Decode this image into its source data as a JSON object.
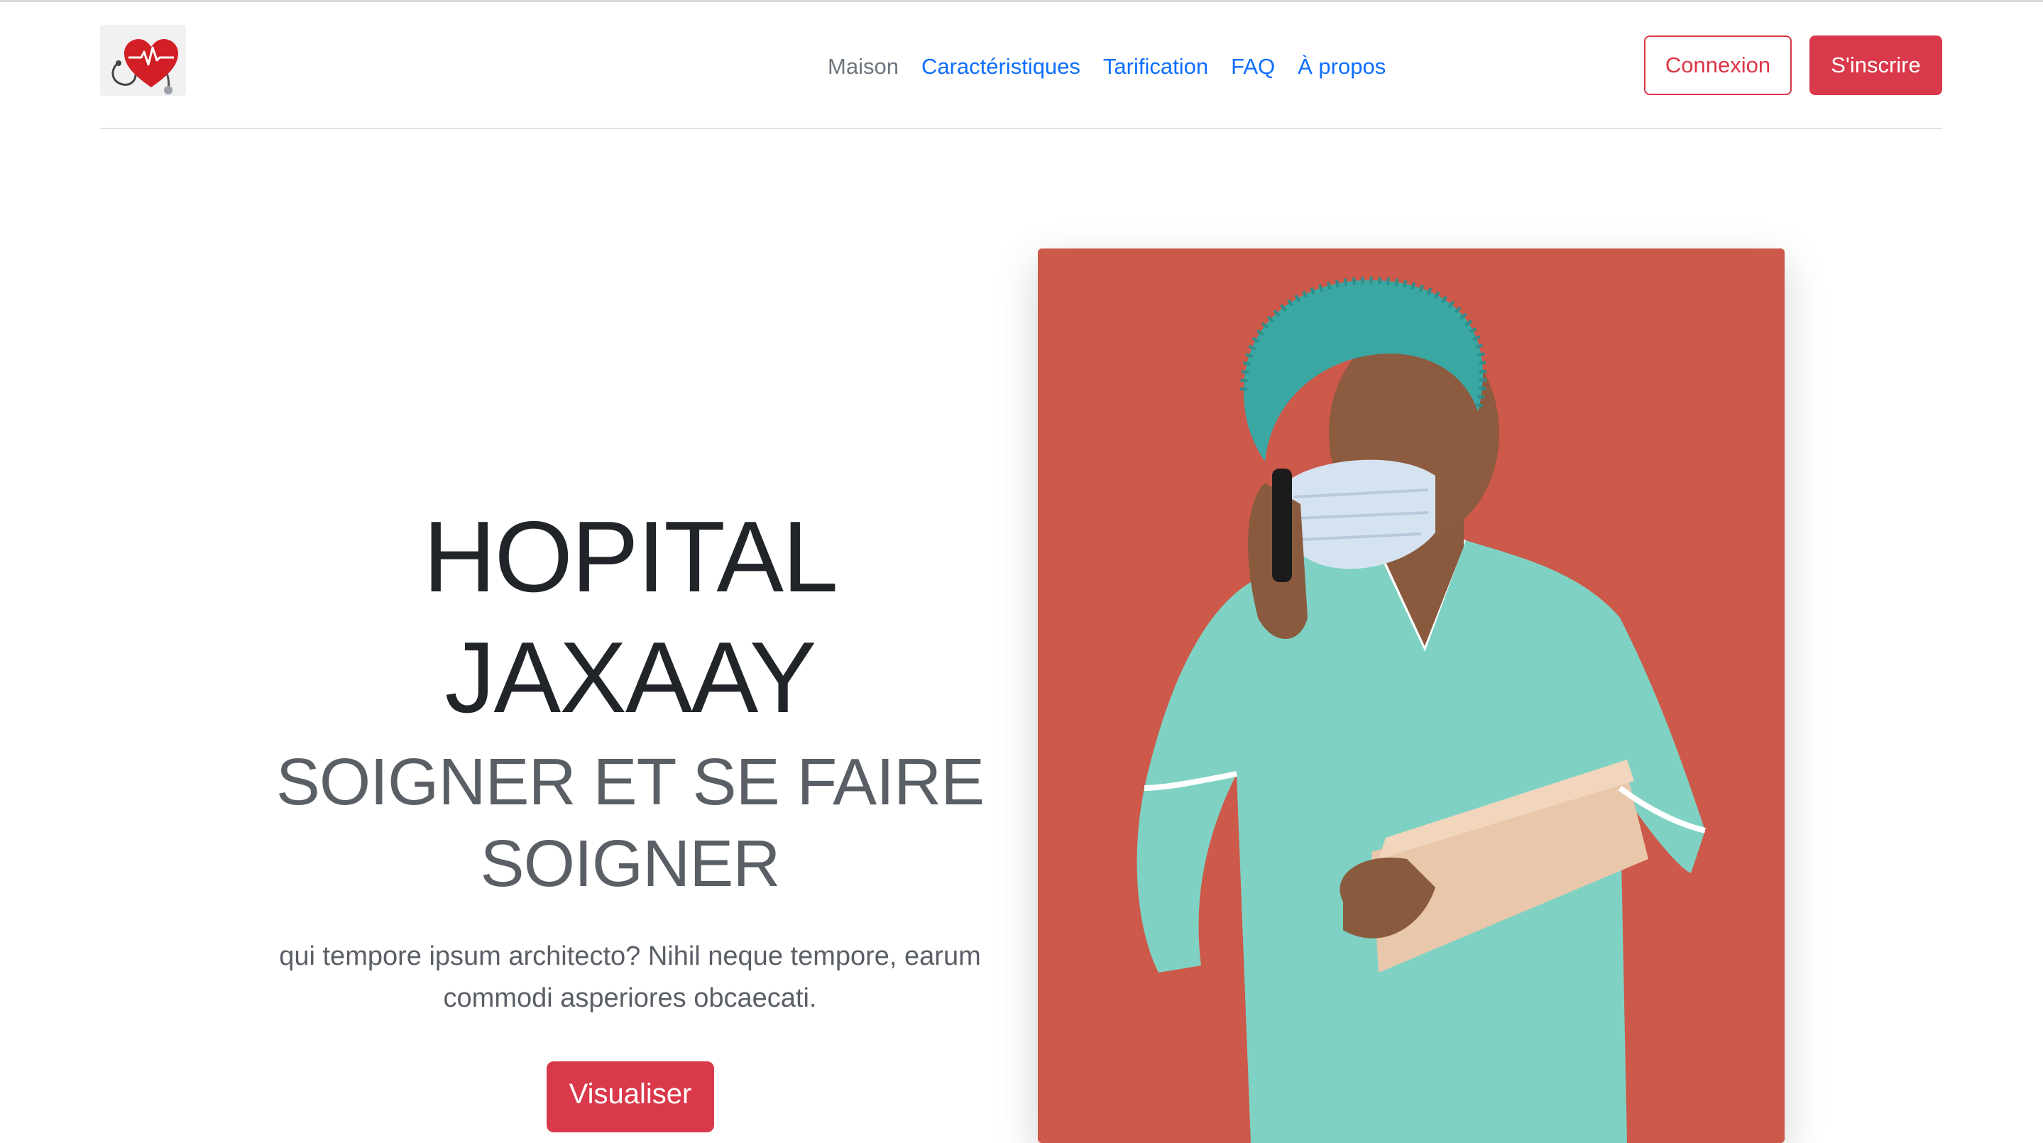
{
  "header": {
    "nav": [
      {
        "label": "Maison",
        "active": true
      },
      {
        "label": "Caractéristiques",
        "active": false
      },
      {
        "label": "Tarification",
        "active": false
      },
      {
        "label": "FAQ",
        "active": false
      },
      {
        "label": "À propos",
        "active": false
      }
    ],
    "login_label": "Connexion",
    "signup_label": "S'inscrire"
  },
  "hero": {
    "title": "HOPITAL JAXAAY",
    "subtitle": "SOIGNER ET SE FAIRE SOIGNER",
    "description": "qui tempore ipsum architecto? Nihil neque tempore, earum commodi asperiores obcaecati.",
    "cta_label": "Visualiser"
  },
  "colors": {
    "primary_link": "#0d6efd",
    "danger": "#dc3545",
    "photo_background": "#cc594a"
  },
  "icons": {
    "logo": "heart-stethoscope-logo"
  }
}
